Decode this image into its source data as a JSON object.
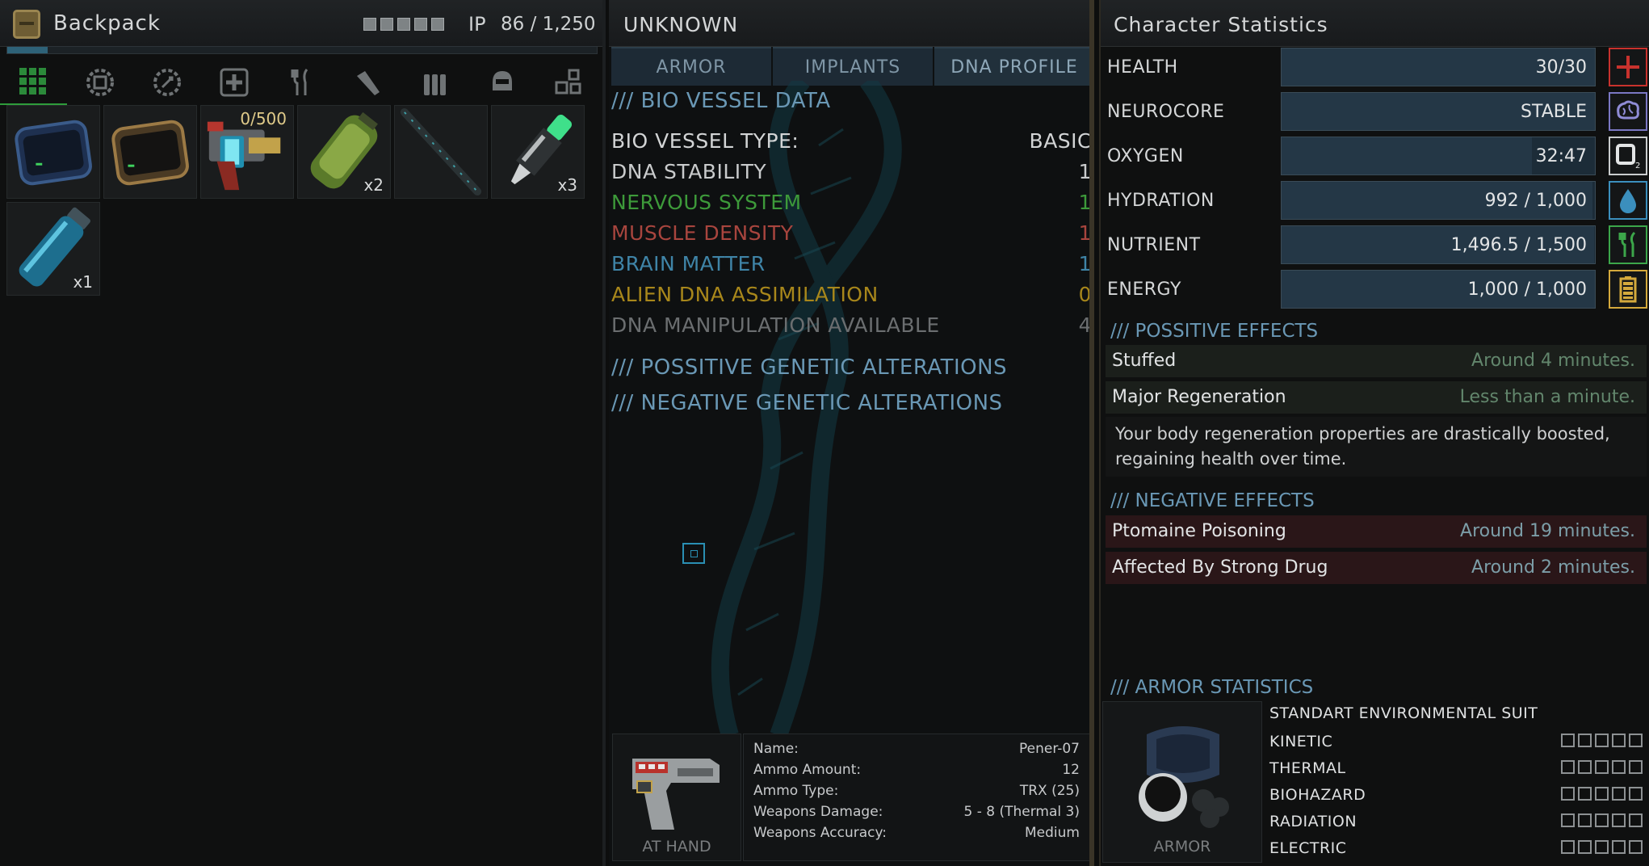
{
  "backpack": {
    "title": "Backpack",
    "ip_label": "IP",
    "ip_value": "86 / 1,250",
    "capacity_fraction": 0.069,
    "filters": [
      "all-grid-icon",
      "armor-gear-icon",
      "tools-gear-icon",
      "medical-icon",
      "food-icon",
      "melee-icon",
      "ammo-icon",
      "helmet-icon",
      "misc-icon"
    ],
    "items": [
      {
        "name": "blue-container-icon",
        "qty": "",
        "top": ""
      },
      {
        "name": "orange-container-icon",
        "qty": "",
        "top": ""
      },
      {
        "name": "energy-gun-icon",
        "qty": "",
        "top": "0/500"
      },
      {
        "name": "green-canister-icon",
        "qty": "x2",
        "top": ""
      },
      {
        "name": "dark-rod-icon",
        "qty": "",
        "top": ""
      },
      {
        "name": "injector-icon",
        "qty": "x3",
        "top": ""
      },
      {
        "name": "blue-cylinder-icon",
        "qty": "x1",
        "top": ""
      }
    ]
  },
  "unknown": {
    "title": "UNKNOWN",
    "tabs": [
      "ARMOR",
      "IMPLANTS",
      "DNA PROFILE"
    ],
    "bio_head": "/// BIO VESSEL DATA",
    "bio_rows": [
      {
        "label": "BIO VESSEL TYPE:",
        "value": "BASIC"
      },
      {
        "label": "DNA STABILITY",
        "value": "1"
      },
      {
        "label": "NERVOUS SYSTEM",
        "value": "1"
      },
      {
        "label": "MUSCLE DENSITY",
        "value": "1"
      },
      {
        "label": "BRAIN MATTER",
        "value": "1"
      },
      {
        "label": "ALIEN DNA ASSIMILATION",
        "value": "0"
      },
      {
        "label": "DNA MANIPULATION AVAILABLE",
        "value": "4"
      }
    ],
    "pos_gen_head": "/// POSSITIVE GENETIC ALTERATIONS",
    "neg_gen_head": "/// NEGATIVE GENETIC ALTERATIONS",
    "weapon": {
      "at_hand": "AT HAND",
      "rows": [
        {
          "k": "Name:",
          "v": "Pener-07"
        },
        {
          "k": "Ammo Amount:",
          "v": "12"
        },
        {
          "k": "Ammo Type:",
          "v": "TRX (25)"
        },
        {
          "k": "Weapons Damage:",
          "v": "5 - 8 (Thermal 3)"
        },
        {
          "k": "Weapons Accuracy:",
          "v": "Medium"
        }
      ]
    }
  },
  "stats": {
    "title": "Character Statistics",
    "vitals": [
      {
        "label": "HEALTH",
        "value": "30/30",
        "fill": 1.0,
        "icon": "health-cross-icon",
        "color": "#c8322d"
      },
      {
        "label": "NEUROCORE",
        "value": "STABLE",
        "fill": 1.0,
        "icon": "brain-icon",
        "color": "#7b78c4"
      },
      {
        "label": "OXYGEN",
        "value": "32:47",
        "fill": 0.8,
        "icon": "oxygen-icon",
        "color": "#c9cccd"
      },
      {
        "label": "HYDRATION",
        "value": "992 / 1,000",
        "fill": 0.992,
        "icon": "water-drop-icon",
        "color": "#3b8fbd"
      },
      {
        "label": "NUTRIENT",
        "value": "1,496.5 / 1,500",
        "fill": 0.998,
        "icon": "fork-knife-icon",
        "color": "#3ca64a"
      },
      {
        "label": "ENERGY",
        "value": "1,000 / 1,000",
        "fill": 1.0,
        "icon": "battery-icon",
        "color": "#d4a93c"
      }
    ],
    "pos_head": "/// POSSITIVE EFFECTS",
    "pos_effects": [
      {
        "name": "Stuffed",
        "time": "Around 4 minutes."
      },
      {
        "name": "Major Regeneration",
        "time": "Less than a minute."
      }
    ],
    "pos_desc": "Your body regeneration properties are drastically boosted, regaining health over time.",
    "neg_head": "/// NEGATIVE EFFECTS",
    "neg_effects": [
      {
        "name": "Ptomaine Poisoning",
        "time": "Around 19 minutes."
      },
      {
        "name": "Affected By Strong Drug",
        "time": "Around 2 minutes."
      }
    ],
    "armor_head": "/// ARMOR STATISTICS",
    "armor_label": "ARMOR",
    "suit_name": "STANDART ENVIRONMENTAL SUIT",
    "armor_stats": [
      {
        "label": "KINETIC",
        "pips": 0
      },
      {
        "label": "THERMAL",
        "pips": 0
      },
      {
        "label": "BIOHAZARD",
        "pips": 0
      },
      {
        "label": "RADIATION",
        "pips": 0
      },
      {
        "label": "ELECTRIC",
        "pips": 0
      }
    ]
  },
  "colors": {
    "section_blue": "#6a98b5",
    "nervous": "#3d9a3a",
    "muscle": "#a8453e",
    "brain": "#3f84a7",
    "alien": "#a8871b",
    "manip": "#6b6e70"
  }
}
